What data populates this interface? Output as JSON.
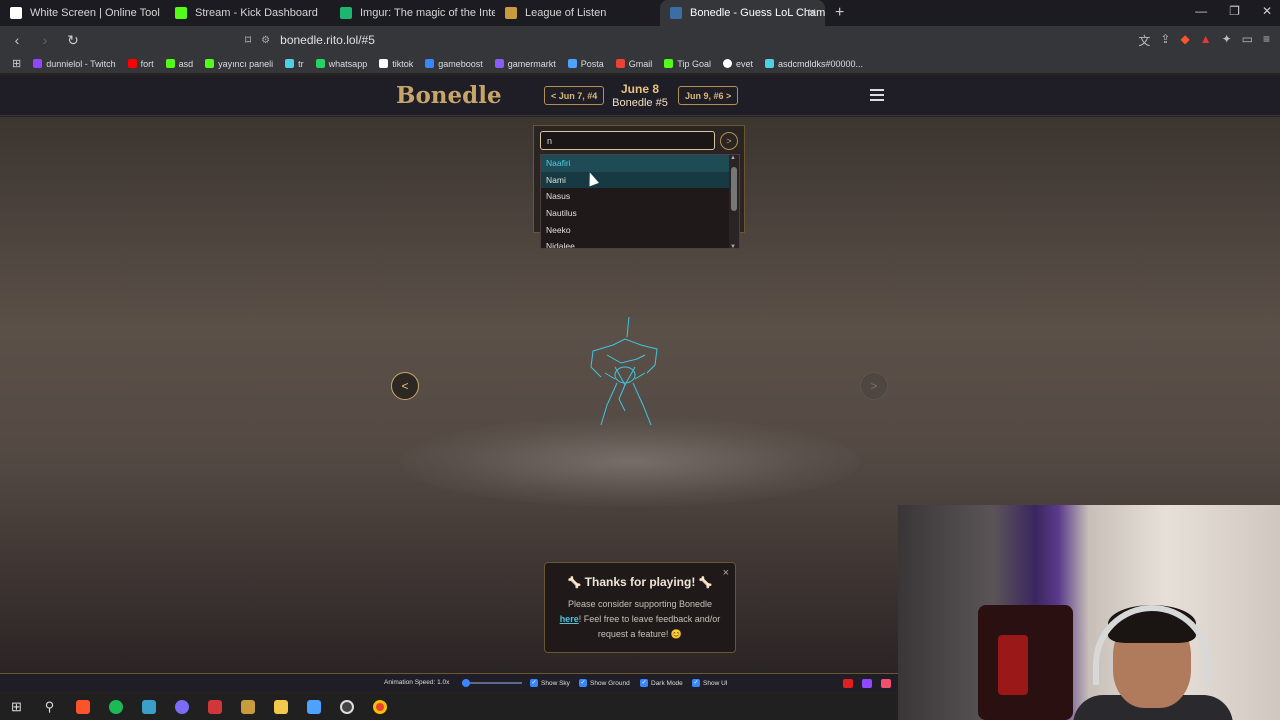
{
  "browser": {
    "tabs": [
      {
        "title": "White Screen | Online Tool",
        "color": "#ffffff",
        "active": false
      },
      {
        "title": "Stream - Kick Dashboard",
        "color": "#53fc18",
        "active": false
      },
      {
        "title": "Imgur: The magic of the Internet",
        "color": "#1bb76e",
        "active": false
      },
      {
        "title": "League of Listen",
        "color": "#c89b3c",
        "active": false
      },
      {
        "title": "Bonedle - Guess LoL Champion",
        "color": "#3a6ea5",
        "active": true
      }
    ],
    "url": "bonedle.rito.lol/#5",
    "bookmarks": [
      {
        "label": "dunnielol - Twitch",
        "color": "#9146ff"
      },
      {
        "label": "fort",
        "color": "#ff0000"
      },
      {
        "label": "asd",
        "color": "#53fc18"
      },
      {
        "label": "yayıncı paneli",
        "color": "#53fc18"
      },
      {
        "label": "tr",
        "color": "#4dd0e1"
      },
      {
        "label": "whatsapp",
        "color": "#25d366"
      },
      {
        "label": "tiktok",
        "color": "#ffffff"
      },
      {
        "label": "gameboost",
        "color": "#3a86ff"
      },
      {
        "label": "gamermarkt",
        "color": "#8a5cf6"
      },
      {
        "label": "Posta",
        "color": "#4da3ff"
      },
      {
        "label": "Gmail",
        "color": "#ea4335"
      },
      {
        "label": "Tip Goal",
        "color": "#53fc18"
      },
      {
        "label": "evet",
        "color": "#ffffff"
      },
      {
        "label": "asdcmdldks#00000...",
        "color": "#4dd0e1"
      }
    ]
  },
  "header": {
    "logo": "Bonedle",
    "prev_label": "< Jun 7, #4",
    "date": "June 8",
    "puzzle": "Bonedle #5",
    "next_label": "Jun 9, #6 >"
  },
  "search": {
    "value": "n",
    "go_label": ">",
    "options": [
      "Naafiri",
      "Nami",
      "Nasus",
      "Nautilus",
      "Neeko",
      "Nidalee"
    ]
  },
  "viewer": {
    "prev_label": "<",
    "next_label": ">"
  },
  "thanks": {
    "title": "Thanks for playing!",
    "line1": "Please consider supporting Bonedle",
    "link": "here",
    "line2": "! Feel free to leave feedback and/or",
    "line3": "request a feature! 😊",
    "close": "×"
  },
  "footer": {
    "speed_label": "Animation Speed: 1.0x",
    "show_sky": "Show Sky",
    "show_ground": "Show Ground",
    "dark_mode": "Dark Mode",
    "show_ui": "Show UI",
    "animation_speed": 1.0
  },
  "colors": {
    "accent": "#c6a56a",
    "selection": "#4dd0e1"
  }
}
